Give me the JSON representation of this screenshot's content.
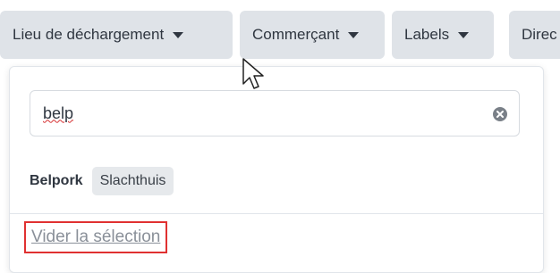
{
  "filters": {
    "unloading_place": "Lieu de déchargement",
    "merchant": "Commerçant",
    "labels": "Labels",
    "director": "Direc"
  },
  "search": {
    "value": "belp",
    "clear_icon": "clear-circle-icon"
  },
  "results": [
    {
      "name": "Belpork",
      "tag": "Slachthuis"
    }
  ],
  "footer": {
    "clear_selection": "Vider la sélection"
  },
  "colors": {
    "button_bg": "#dfe3e8",
    "highlight_border": "#e03131",
    "spellcheck": "#d63031"
  }
}
